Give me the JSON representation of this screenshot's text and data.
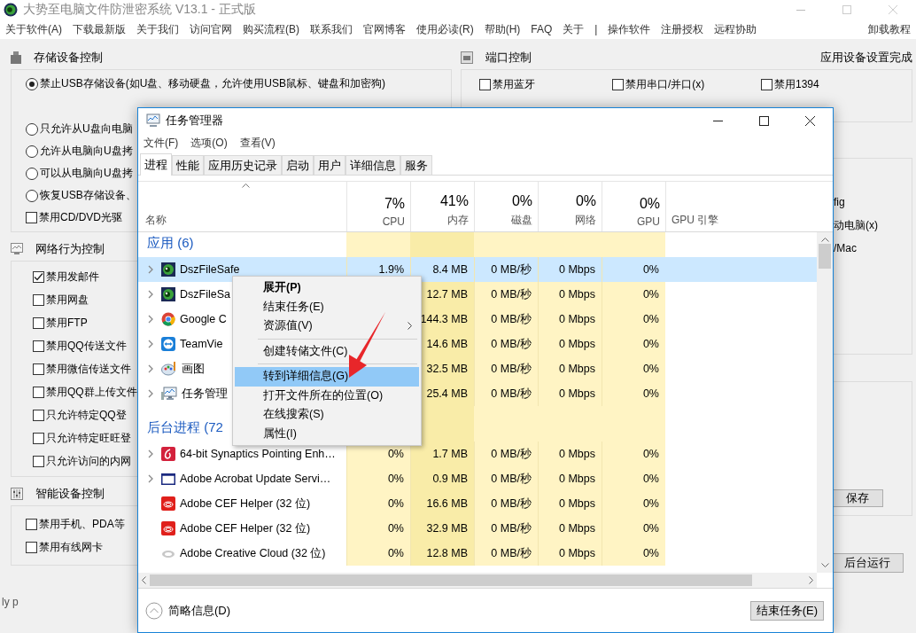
{
  "app": {
    "title": "大势至电脑文件防泄密系统 V13.1 - 正式版",
    "menu": [
      "关于软件(A)",
      "下载最新版",
      "关于我们",
      "访问官网",
      "购买流程(B)",
      "联系我们",
      "官网博客",
      "使用必读(R)",
      "帮助(H)",
      "FAQ",
      "关于",
      "|",
      "操作软件",
      "注册授权",
      "远程协助"
    ],
    "menu_right": "卸载教程",
    "storage": {
      "title": "存储设备控制",
      "options": [
        {
          "kind": "radio",
          "label": "禁止USB存储设备(如U盘、移动硬盘，允许使用USB鼠标、键盘和加密狗)",
          "selected": true
        },
        {
          "kind": "radio",
          "label": "只允许从U盘向电脑",
          "selected": false
        },
        {
          "kind": "radio",
          "label": "允许从电脑向U盘拷",
          "selected": false
        },
        {
          "kind": "radio",
          "label": "可以从电脑向U盘拷",
          "selected": false
        },
        {
          "kind": "radio",
          "label": "恢复USB存储设备、",
          "selected": false
        },
        {
          "kind": "checkbox",
          "label": "禁用CD/DVD光驱",
          "checked": false
        }
      ]
    },
    "network": {
      "title": "网络行为控制",
      "items": [
        {
          "label": "禁用发邮件",
          "checked": true
        },
        {
          "label": "禁用网盘",
          "checked": false
        },
        {
          "label": "禁用FTP",
          "checked": false
        },
        {
          "label": "禁用QQ传送文件",
          "checked": false
        },
        {
          "label": "禁用微信传送文件",
          "checked": false
        },
        {
          "label": "禁用QQ群上传文件",
          "checked": false
        },
        {
          "label": "只允许特定QQ登",
          "checked": false
        },
        {
          "label": "只允许特定旺旺登",
          "checked": false
        },
        {
          "label": "只允许访问的内网",
          "checked": false
        }
      ]
    },
    "smart": {
      "title": "智能设备控制",
      "items": [
        {
          "label": "禁用手机、PDA等",
          "checked": false
        },
        {
          "label": "禁用有线网卡",
          "checked": false
        }
      ]
    },
    "port": {
      "title": "端口控制",
      "status": "应用设备设置完成",
      "items": [
        {
          "label": "禁用蓝牙",
          "checked": false
        },
        {
          "label": "禁用串口/并口(x)",
          "checked": false
        },
        {
          "label": "禁用1394",
          "checked": false
        }
      ]
    },
    "fragments": [
      "fig",
      "动电脑(x)",
      "/Mac"
    ],
    "save_button": "保存",
    "background_button": "后台运行",
    "status": "ly  p"
  },
  "task_manager": {
    "title": "任务管理器",
    "menu": [
      "文件(F)",
      "选项(O)",
      "查看(V)"
    ],
    "tabs": [
      {
        "label": "进程",
        "selected": true
      },
      {
        "label": "性能",
        "selected": false
      },
      {
        "label": "应用历史记录",
        "selected": false
      },
      {
        "label": "启动",
        "selected": false
      },
      {
        "label": "用户",
        "selected": false
      },
      {
        "label": "详细信息",
        "selected": false
      },
      {
        "label": "服务",
        "selected": false
      }
    ],
    "name_column": "名称",
    "columns": [
      {
        "percent": "7%",
        "label": "CPU"
      },
      {
        "percent": "41%",
        "label": "内存"
      },
      {
        "percent": "0%",
        "label": "磁盘"
      },
      {
        "percent": "0%",
        "label": "网络"
      },
      {
        "percent": "0%",
        "label": "GPU"
      },
      {
        "label": "GPU 引擎"
      }
    ],
    "groups": [
      {
        "label": "应用 (6)",
        "rows": [
          {
            "kind": "dsz",
            "name": "DszFileSafe",
            "expandable": true,
            "selected": true,
            "cpu": "1.9%",
            "memory": "8.4 MB",
            "disk": "0 MB/秒",
            "network": "0 Mbps",
            "gpu": "0%"
          },
          {
            "kind": "dsz",
            "name": "DszFileSa",
            "expandable": true,
            "selected": false,
            "memory": "12.7 MB",
            "disk": "0 MB/秒",
            "network": "0 Mbps",
            "gpu": "0%"
          },
          {
            "kind": "chrome",
            "name": "Google C",
            "expandable": true,
            "selected": false,
            "memory": "144.3 MB",
            "disk": "0 MB/秒",
            "network": "0 Mbps",
            "gpu": "0%"
          },
          {
            "kind": "teamviewer",
            "name": "TeamVie",
            "expandable": true,
            "selected": false,
            "memory": "14.6 MB",
            "disk": "0 MB/秒",
            "network": "0 Mbps",
            "gpu": "0%"
          },
          {
            "kind": "paint",
            "name": "画图",
            "expandable": true,
            "selected": false,
            "memory": "32.5 MB",
            "disk": "0 MB/秒",
            "network": "0 Mbps",
            "gpu": "0%"
          },
          {
            "kind": "taskmgr",
            "name": "任务管理",
            "expandable": true,
            "selected": false,
            "memory": "25.4 MB",
            "disk": "0 MB/秒",
            "network": "0 Mbps",
            "gpu": "0%"
          }
        ]
      },
      {
        "label": "后台进程 (72",
        "rows": [
          {
            "kind": "synaptics",
            "name": "64-bit Synaptics Pointing Enh…",
            "expandable": true,
            "selected": false,
            "cpu": "0%",
            "memory": "1.7 MB",
            "disk": "0 MB/秒",
            "network": "0 Mbps",
            "gpu": "0%"
          },
          {
            "kind": "acrobat",
            "name": "Adobe Acrobat Update Servi…",
            "expandable": true,
            "selected": false,
            "cpu": "0%",
            "memory": "0.9 MB",
            "disk": "0 MB/秒",
            "network": "0 Mbps",
            "gpu": "0%"
          },
          {
            "kind": "adobe",
            "name": "Adobe CEF Helper (32 位)",
            "expandable": false,
            "selected": false,
            "cpu": "0%",
            "memory": "16.6 MB",
            "disk": "0 MB/秒",
            "network": "0 Mbps",
            "gpu": "0%"
          },
          {
            "kind": "adobe",
            "name": "Adobe CEF Helper (32 位)",
            "expandable": false,
            "selected": false,
            "cpu": "0%",
            "memory": "32.9 MB",
            "disk": "0 MB/秒",
            "network": "0 Mbps",
            "gpu": "0%"
          },
          {
            "kind": "cloud",
            "name": "Adobe Creative Cloud (32 位)",
            "expandable": false,
            "selected": false,
            "cpu": "0%",
            "memory": "12.8 MB",
            "disk": "0 MB/秒",
            "network": "0 Mbps",
            "gpu": "0%"
          }
        ]
      }
    ],
    "fewer_details": "简略信息(D)",
    "end_task": "结束任务(E)",
    "context_menu": [
      {
        "kind": "item",
        "label": "展开(P)",
        "bold": true,
        "selected": false
      },
      {
        "kind": "item",
        "label": "结束任务(E)",
        "bold": false,
        "selected": false
      },
      {
        "kind": "submenu",
        "label": "资源值(V)",
        "bold": false,
        "selected": false
      },
      {
        "kind": "separator"
      },
      {
        "kind": "item",
        "label": "创建转储文件(C)",
        "bold": false,
        "selected": false
      },
      {
        "kind": "separator"
      },
      {
        "kind": "item",
        "label": "转到详细信息(G)",
        "bold": false,
        "selected": true
      },
      {
        "kind": "item",
        "label": "打开文件所在的位置(O)",
        "bold": false,
        "selected": false
      },
      {
        "kind": "item",
        "label": "在线搜索(S)",
        "bold": false,
        "selected": false
      },
      {
        "kind": "item",
        "label": "属性(I)",
        "bold": false,
        "selected": false
      }
    ]
  }
}
